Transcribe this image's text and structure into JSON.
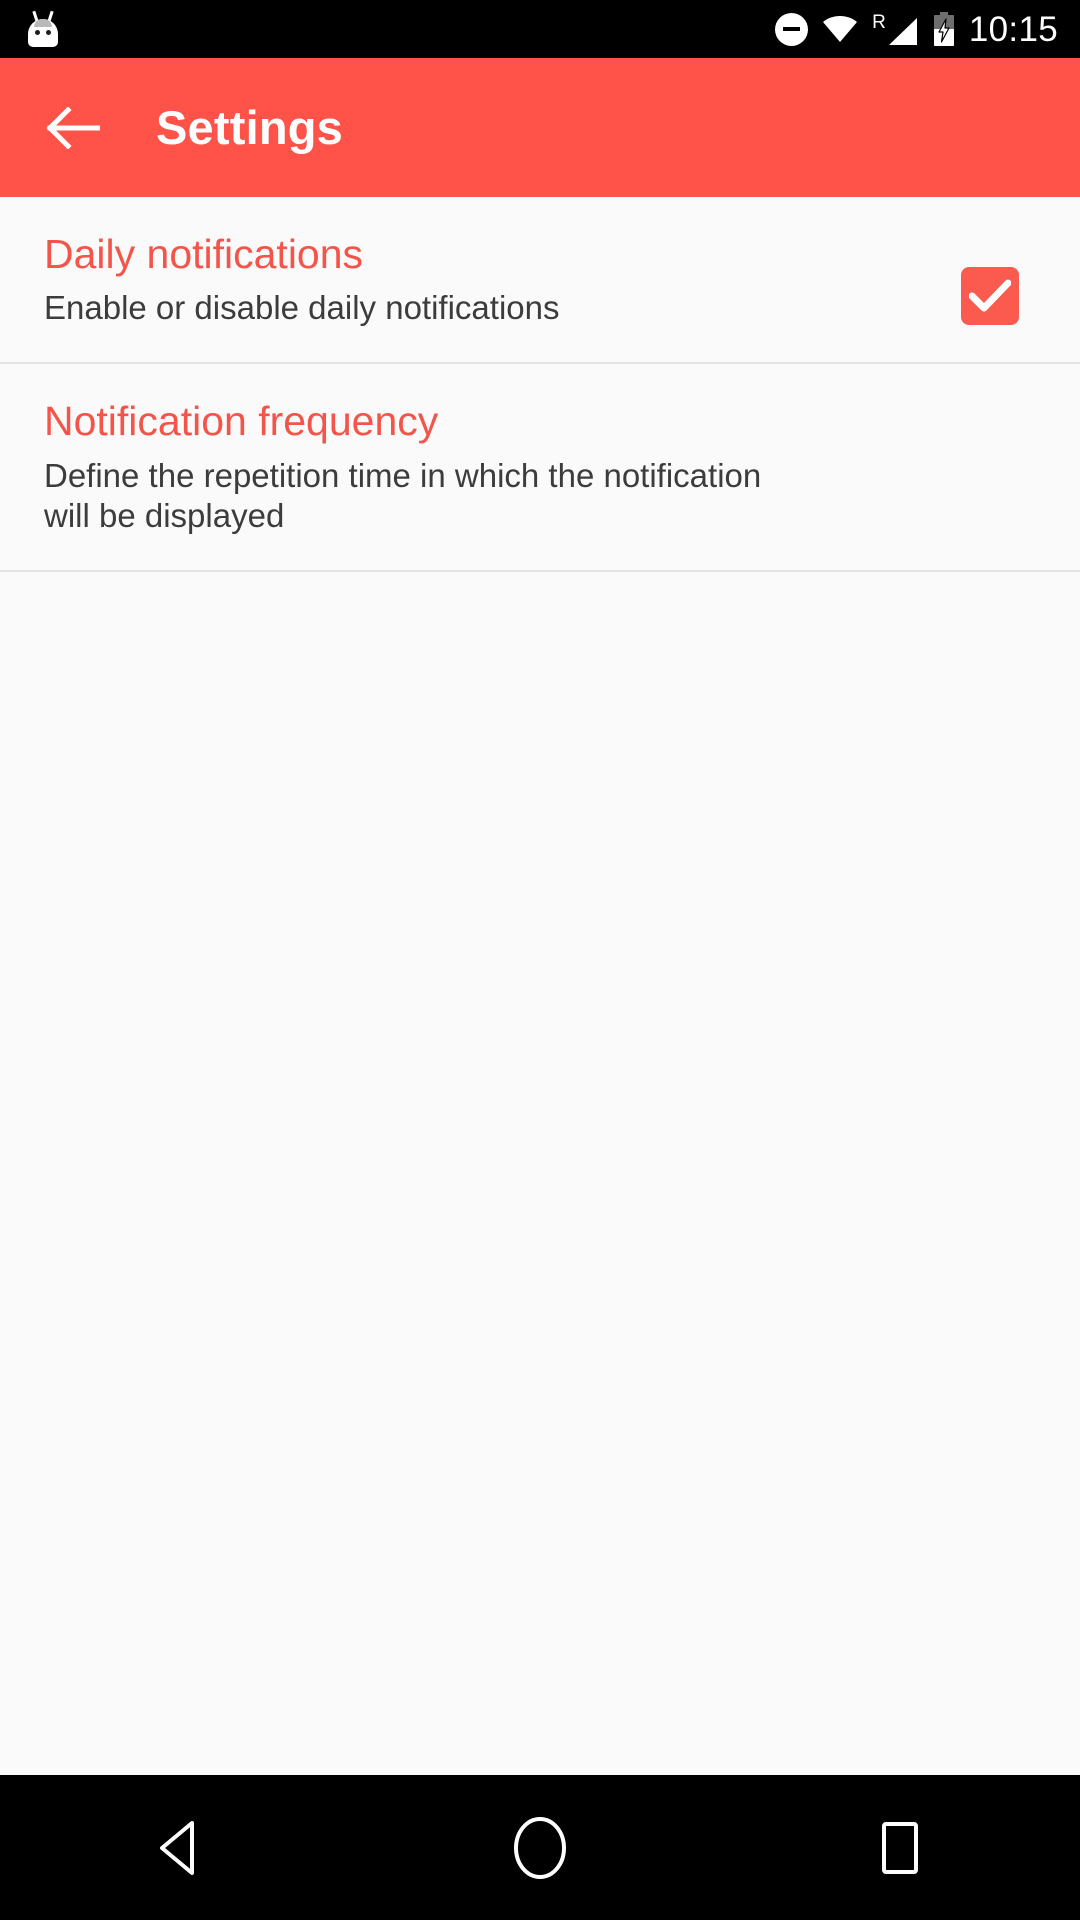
{
  "status_bar": {
    "app_icon": "cyanogenmod-robot-icon",
    "icons": [
      {
        "name": "do-not-disturb-icon",
        "label": "Do not disturb"
      },
      {
        "name": "wifi-icon",
        "label": "Wi-Fi full signal"
      },
      {
        "name": "roaming-indicator",
        "label": "R"
      },
      {
        "name": "cellular-signal-icon",
        "label": "Cellular signal"
      },
      {
        "name": "battery-charging-icon",
        "label": "Battery charging"
      }
    ],
    "roaming_letter": "R",
    "time": "10:15"
  },
  "app_bar": {
    "back_label": "Back",
    "title": "Settings",
    "background_color": "#FF5249",
    "title_color": "#FFFFFF"
  },
  "preferences": [
    {
      "title": "Daily notifications",
      "summary": "Enable or disable daily notifications",
      "widget": "checkbox",
      "checked": true
    },
    {
      "title": "Notification frequency",
      "summary": "Define the repetition time in which the notification will be displayed",
      "widget": "none",
      "checked": false
    }
  ],
  "nav_bar": {
    "buttons": [
      {
        "name": "back-nav-button",
        "label": "Back"
      },
      {
        "name": "home-nav-button",
        "label": "Home"
      },
      {
        "name": "recents-nav-button",
        "label": "Recents"
      }
    ]
  },
  "colors": {
    "accent": "#F4554A",
    "app_bar": "#FF5249",
    "checkbox_fill": "#FB5A4E",
    "background": "#FAFAFA",
    "summary_text": "#3C3C3C",
    "divider": "#E4E4E4"
  }
}
